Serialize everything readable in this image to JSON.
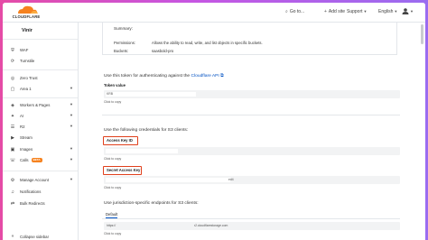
{
  "header": {
    "logo_text": "CLOUDFLARE",
    "search_label": "Go to...",
    "add_site_label": "Add site",
    "support_label": "Support",
    "language_label": "English"
  },
  "sidebar": {
    "account_name": "Vinir",
    "items": [
      {
        "label": "WAF",
        "icon": "waf-icon"
      },
      {
        "label": "Turnstile",
        "icon": "turnstile-icon"
      },
      {
        "label": "Zero Trust",
        "icon": "zero-trust-icon"
      },
      {
        "label": "Area 1",
        "icon": "area1-icon"
      },
      {
        "label": "Workers & Pages",
        "icon": "workers-icon"
      },
      {
        "label": "AI",
        "icon": "ai-icon"
      },
      {
        "label": "R2",
        "icon": "r2-icon"
      },
      {
        "label": "Stream",
        "icon": "stream-icon"
      },
      {
        "label": "Images",
        "icon": "images-icon"
      },
      {
        "label": "Calls",
        "icon": "calls-icon",
        "badge": "BETA"
      },
      {
        "label": "Manage Account",
        "icon": "manage-account-icon"
      },
      {
        "label": "Notifications",
        "icon": "notifications-icon"
      },
      {
        "label": "Bulk Redirects",
        "icon": "bulk-redirects-icon"
      }
    ],
    "collapse_label": "Collapse sidebar"
  },
  "summary": {
    "title": "Summary:",
    "permissions_label": "Permissions:",
    "permissions_value": "Allows the ability to read, write, and list objects in specific buckets.",
    "buckets_label": "Buckets:",
    "buckets_value": "saasbold-pro"
  },
  "api_token": {
    "description": "Use this token for authenticating against the",
    "link_text": "Cloudflare API",
    "label": "Token value",
    "value": "KRB",
    "copy_label": "Click to copy"
  },
  "s3": {
    "description": "Use the following credentials for S3 clients:",
    "access_key_label": "Access Key ID",
    "access_key_copy": "Click to copy",
    "secret_key_label": "Secret Access Key",
    "secret_key_tail": "ed4",
    "secret_key_copy": "Click to copy"
  },
  "endpoints": {
    "description": "Use jurisdiction-specific endpoints for S3 clients:",
    "tab_label": "Default",
    "endpoint_prefix": "https://",
    "endpoint_host": "r2.cloudflarestorage.com",
    "copy_label": "Click to copy"
  },
  "colors": {
    "accent": "#f6821f",
    "link": "#0051c3",
    "highlight": "#e0401c"
  }
}
